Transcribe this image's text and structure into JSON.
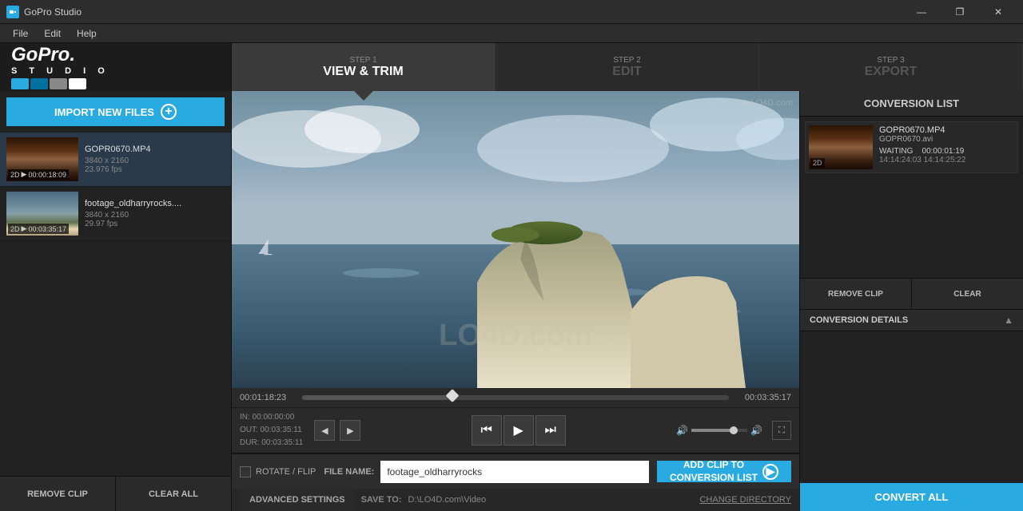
{
  "titlebar": {
    "title": "GoPro Studio",
    "icon": "G",
    "minimize": "—",
    "restore": "❐",
    "close": "✕"
  },
  "menubar": {
    "items": [
      "File",
      "Edit",
      "Help"
    ]
  },
  "logo": {
    "brand": "GoPro.",
    "studio": "S T U D I O",
    "colors": [
      "#29abe2",
      "#0070a0",
      "#888888",
      "#ffffff"
    ]
  },
  "steps": [
    {
      "number": "STEP 1",
      "name": "VIEW & TRIM",
      "active": true
    },
    {
      "number": "STEP 2",
      "name": "EDIT",
      "active": false
    },
    {
      "number": "STEP 3",
      "name": "EXPORT",
      "active": false
    }
  ],
  "sidebar": {
    "import_btn": "IMPORT NEW FILES",
    "files": [
      {
        "name": "GOPR0670.MP4",
        "resolution": "3840 x 2160",
        "fps": "23.976 fps",
        "duration": "00:00:18:09",
        "badge": "2D"
      },
      {
        "name": "footage_oldharryrocks....",
        "resolution": "3840 x 2160",
        "fps": "29.97 fps",
        "duration": "00:03:35:17",
        "badge": "2D"
      }
    ],
    "remove_clip": "REMOVE CLIP",
    "clear_all": "CLEAR ALL"
  },
  "video": {
    "time_current": "00:01:18:23",
    "time_total": "00:03:35:17",
    "in_point": "IN:  00:00:00:00",
    "out_point": "OUT: 00:03:35:11",
    "duration": "DUR: 00:03:35:11"
  },
  "bottom_panel": {
    "rotate_flip_label": "ROTATE / FLIP",
    "file_name_label": "FILE NAME:",
    "file_name_value": "footage_oldharryrocks",
    "save_to_label": "SAVE TO:",
    "save_to_path": "D:\\LO4D.com\\Video",
    "change_dir": "CHANGE DIRECTORY",
    "advanced_settings": "ADVANCED SETTINGS",
    "add_clip_btn": "ADD CLIP TO\nCONVERSION LIST"
  },
  "conversion_list": {
    "header": "CONVERSION LIST",
    "item": {
      "filename": "GOPR0670.MP4",
      "output": "GOPR0670.avi",
      "status": "WAITING",
      "badge": "2D",
      "duration": "00:00:01:19",
      "time_range": "14:14:24:03  14:14:25:22"
    },
    "remove_clip_btn": "REMOVE CLIP",
    "clear_btn": "CLEAR",
    "details_header": "CONVERSION DETAILS",
    "convert_all_btn": "CONVERT ALL"
  }
}
